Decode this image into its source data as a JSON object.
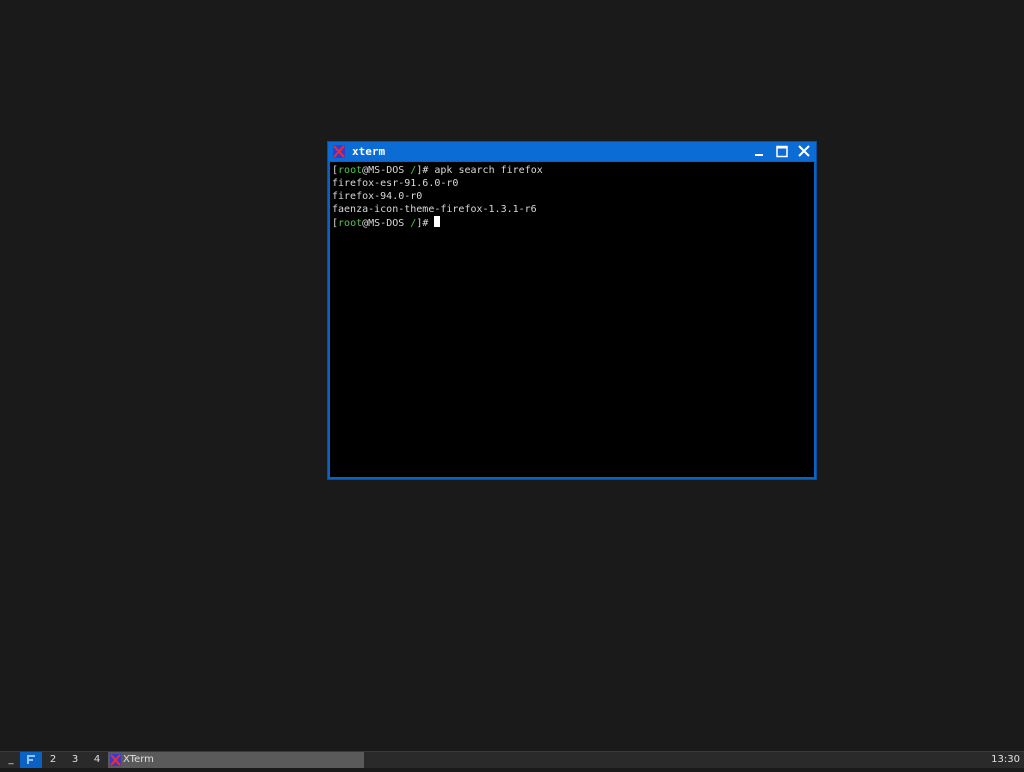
{
  "window": {
    "title": "xterm",
    "icon": "xterm-x-icon"
  },
  "terminal": {
    "lines": [
      {
        "user": "root",
        "host_part": "@MS-DOS ",
        "path": "/",
        "suffix": "]# apk search firefox"
      },
      {
        "text": "firefox-esr-91.6.0-r0"
      },
      {
        "text": "firefox-94.0-r0"
      },
      {
        "text": "faenza-icon-theme-firefox-1.3.1-r6"
      },
      {
        "user": "root",
        "host_part": "@MS-DOS ",
        "path": "/",
        "suffix": "]# "
      }
    ]
  },
  "taskbar": {
    "workspaces": [
      "1",
      "2",
      "3",
      "4"
    ],
    "task_label": "XTerm",
    "clock": "13:30",
    "menu_label": "_"
  },
  "colors": {
    "accent": "#0a62c4",
    "prompt_green": "#4fc84f",
    "desktop": "#1a1a1a"
  }
}
